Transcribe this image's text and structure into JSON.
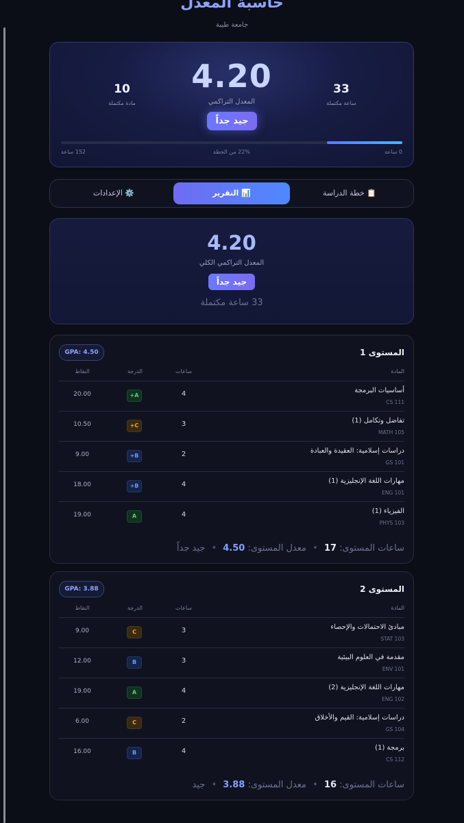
{
  "header": {
    "title": "حاسبة المعدل",
    "subtitle": "جامعة طيبة"
  },
  "hero": {
    "gpa": "4.20",
    "gpa_label": "المعدل التراكمي",
    "rating": "جيد جداً",
    "hours_value": "33",
    "hours_label": "ساعة مكتملة",
    "courses_value": "10",
    "courses_label": "مادة مكتملة",
    "progress_fraction": 0.22,
    "progress_start": "0 ساعة",
    "progress_middle": "22% من الخطة",
    "progress_end": "152 ساعة"
  },
  "tabs": [
    {
      "label": "📋 خطة الدراسة"
    },
    {
      "label": "📊 التقرير"
    },
    {
      "label": "⚙️ الإعدادات"
    }
  ],
  "summary": {
    "gpa": "4.20",
    "label": "المعدل التراكمي الكلي",
    "rating": "جيد جداً",
    "hours": "33 ساعة مكتملة"
  },
  "table_headers": {
    "course": "المادة",
    "hours": "ساعات",
    "grade": "الدرجة",
    "points": "النقاط"
  },
  "levels": [
    {
      "title": "المستوى 1",
      "gpa_badge": "GPA: 4.50",
      "courses": [
        {
          "name": "أساسيات البرمجة",
          "code": "CS 111",
          "hours": "4",
          "grade": "A+",
          "points": "20.00",
          "color": "green"
        },
        {
          "name": "تفاضل وتكامل (1)",
          "code": "MATH 105",
          "hours": "3",
          "grade": "C+",
          "points": "10.50",
          "color": "orange"
        },
        {
          "name": "دراسات إسلامية: العقيدة والعبادة",
          "code": "GS 101",
          "hours": "2",
          "grade": "B+",
          "points": "9.00",
          "color": "blue"
        },
        {
          "name": "مهارات اللغة الإنجليزية (1)",
          "code": "ENG 101",
          "hours": "4",
          "grade": "B+",
          "points": "18.00",
          "color": "blue"
        },
        {
          "name": "الفيزياء (1)",
          "code": "PHYS 103",
          "hours": "4",
          "grade": "A",
          "points": "19.00",
          "color": "green"
        }
      ],
      "footer": {
        "hours_label": "ساعات المستوى:",
        "hours": "17",
        "gpa_label": "معدل المستوى:",
        "gpa": "4.50",
        "rating": "جيد جداً"
      }
    },
    {
      "title": "المستوى 2",
      "gpa_badge": "GPA: 3.88",
      "courses": [
        {
          "name": "مبادئ الاحتمالات والإحصاء",
          "code": "STAT 103",
          "hours": "3",
          "grade": "C",
          "points": "9.00",
          "color": "orange"
        },
        {
          "name": "مقدمة في العلوم البيئية",
          "code": "ENV 101",
          "hours": "3",
          "grade": "B",
          "points": "12.00",
          "color": "blue"
        },
        {
          "name": "مهارات اللغة الإنجليزية (2)",
          "code": "ENG 102",
          "hours": "4",
          "grade": "A",
          "points": "19.00",
          "color": "green"
        },
        {
          "name": "دراسات إسلامية: القيم والأخلاق",
          "code": "GS 104",
          "hours": "2",
          "grade": "C",
          "points": "6.00",
          "color": "orange"
        },
        {
          "name": "برمجة (1)",
          "code": "CS 112",
          "hours": "4",
          "grade": "B",
          "points": "16.00",
          "color": "blue"
        }
      ],
      "footer": {
        "hours_label": "ساعات المستوى:",
        "hours": "16",
        "gpa_label": "معدل المستوى:",
        "gpa": "3.88",
        "rating": "جيد"
      }
    }
  ]
}
